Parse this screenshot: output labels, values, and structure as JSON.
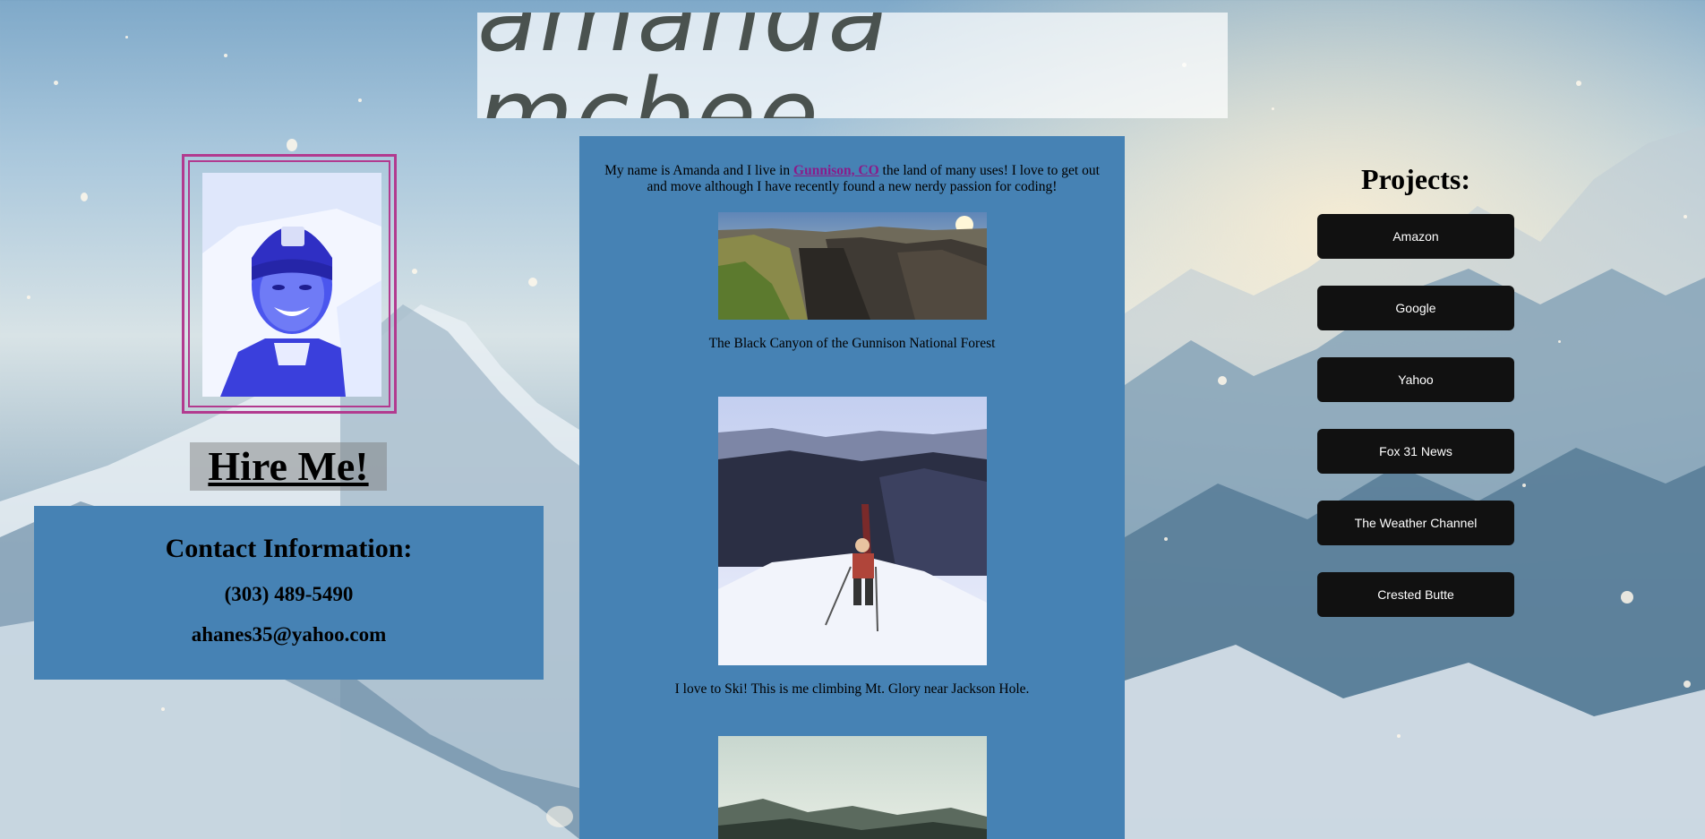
{
  "header": {
    "title": "amanda mcbee"
  },
  "intro": {
    "text_before": "My name is Amanda and I live in ",
    "link_text": "Gunnison, CO",
    "text_after": " the land of many uses! I love to get out and move although I have recently found a new nerdy passion for coding!"
  },
  "gallery": [
    {
      "caption": "The Black Canyon of the Gunnison National Forest"
    },
    {
      "caption": "I love to Ski! This is me climbing Mt. Glory near Jackson Hole."
    },
    {
      "caption": ""
    }
  ],
  "hire": {
    "label": "Hire Me!"
  },
  "contact": {
    "title": "Contact Information:",
    "phone": "(303) 489-5490",
    "email": "ahanes35@yahoo.com"
  },
  "projects": {
    "title": "Projects:",
    "items": [
      "Amazon",
      "Google",
      "Yahoo",
      "Fox 31 News",
      "The Weather Channel",
      "Crested Butte"
    ]
  },
  "colors": {
    "panel": "#4682b4",
    "button": "#111111",
    "frame": "#b23a8f",
    "link": "#8a1c8a"
  }
}
